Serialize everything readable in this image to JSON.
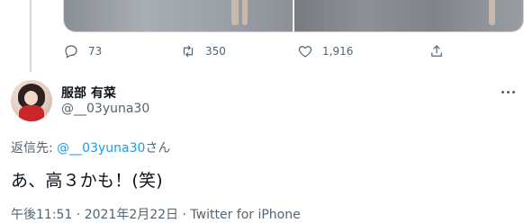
{
  "previous_tweet": {
    "actions": {
      "reply_count": "73",
      "retweet_count": "350",
      "like_count": "1,916"
    }
  },
  "reply": {
    "display_name": "服部 有菜",
    "handle": "@__03yuna30",
    "reply_to_label": "返信先: ",
    "reply_to_mention": "@__03yuna30",
    "reply_to_suffix": "さん",
    "text": "あ、高３かも！(笑)",
    "timestamp": "午後11:51 · 2021年2月22日 · Twitter for iPhone"
  },
  "icons": {
    "reply": "reply-icon",
    "retweet": "retweet-icon",
    "like": "heart-icon",
    "share": "share-icon",
    "more": "more-icon"
  },
  "colors": {
    "text_primary": "#0f1419",
    "text_secondary": "#536471",
    "link": "#1d9bf0",
    "border": "#cfd9de"
  }
}
